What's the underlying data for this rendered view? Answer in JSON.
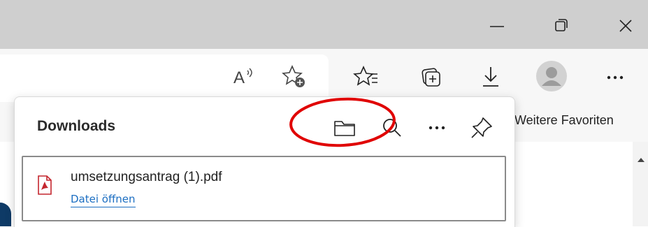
{
  "window": {
    "controls": {
      "minimize": "minimize-icon",
      "restore": "restore-icon",
      "close": "close-icon"
    }
  },
  "toolbar": {
    "icons": [
      "read-aloud-icon",
      "add-favorite-icon",
      "favorites-icon",
      "collections-icon",
      "downloads-icon",
      "profile-icon",
      "more-icon"
    ]
  },
  "favorites_bar": {
    "label": "Weitere Favoriten"
  },
  "downloads_panel": {
    "title": "Downloads",
    "actions": [
      "open-folder-icon",
      "search-icon",
      "more-options-icon",
      "pin-icon"
    ],
    "items": [
      {
        "file_name": "umsetzungsantrag (1).pdf",
        "action_label": "Datei öffnen",
        "icon": "pdf-file-icon"
      }
    ]
  },
  "annotation": {
    "highlight_color": "#e00000",
    "target": "open-folder-icon"
  }
}
